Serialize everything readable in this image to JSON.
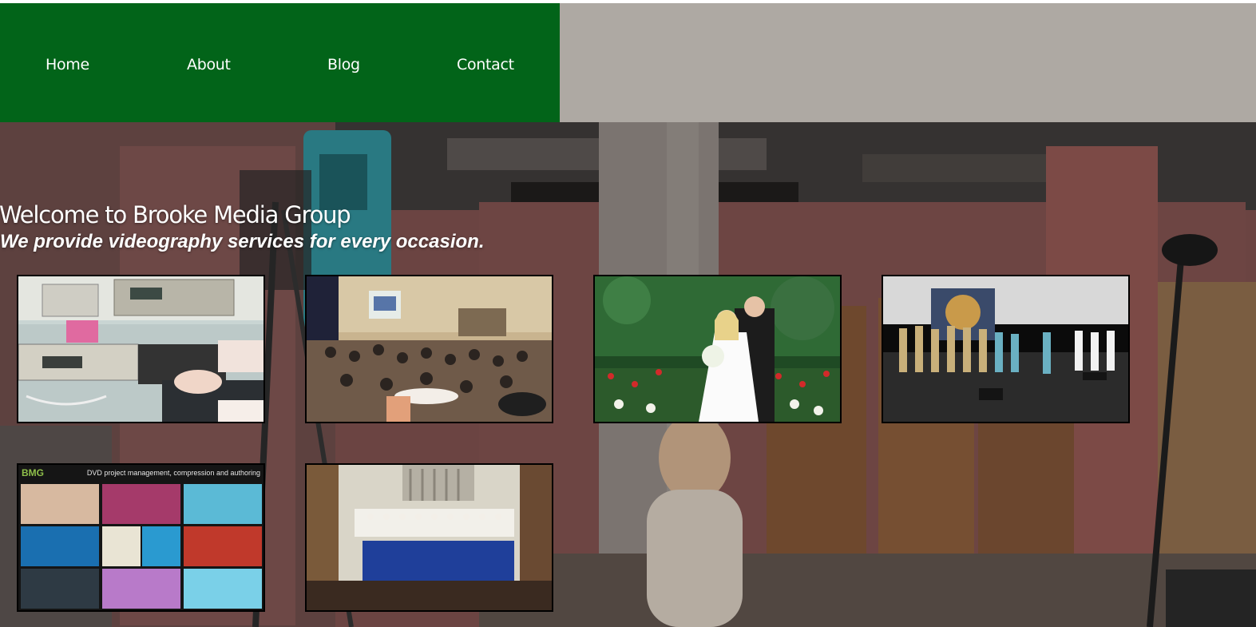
{
  "nav": {
    "items": [
      {
        "label": "Home"
      },
      {
        "label": "About"
      },
      {
        "label": "Blog"
      },
      {
        "label": "Contact"
      }
    ]
  },
  "hero": {
    "title": "Welcome to Brooke Media Group",
    "subtitle": "We provide videography services for every occasion."
  },
  "gallery": {
    "dvd": {
      "logo": "BMG",
      "caption": "DVD project management, compression and authoring"
    }
  },
  "colors": {
    "nav_green": "#026419",
    "nav_gray": "#aea9a3",
    "thumb_border": "#000000"
  }
}
